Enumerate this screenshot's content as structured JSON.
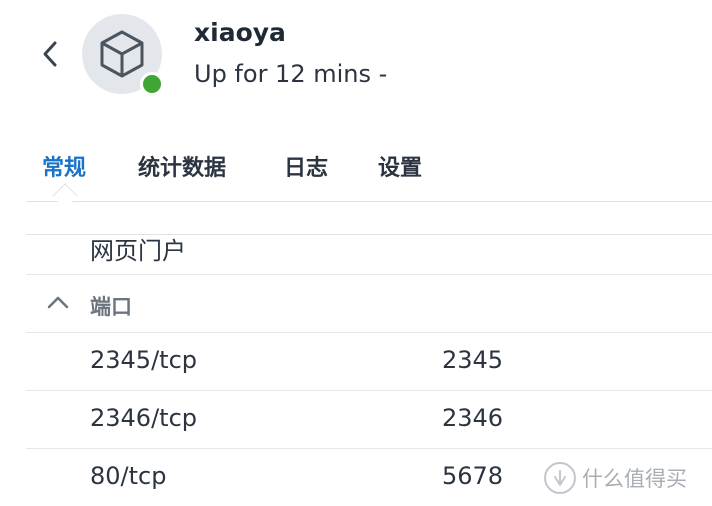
{
  "header": {
    "title": "xiaoya",
    "subtitle": "Up for 12 mins -",
    "status_color": "#3fa535"
  },
  "tabs": [
    {
      "label": "常规",
      "active": true
    },
    {
      "label": "统计数据",
      "active": false
    },
    {
      "label": "日志",
      "active": false
    },
    {
      "label": "设置",
      "active": false
    }
  ],
  "list": {
    "partial_row_label": "网页门户",
    "ports_section": {
      "label": "端口",
      "expanded": true,
      "rows": [
        {
          "container": "2345/tcp",
          "host": "2345"
        },
        {
          "container": "2346/tcp",
          "host": "2346"
        },
        {
          "container": "80/tcp",
          "host": "5678"
        }
      ]
    }
  },
  "watermark": {
    "text": "什么值得买"
  },
  "colors": {
    "accent": "#1a73c8",
    "text": "#2b3440",
    "divider": "#dfe3e8"
  }
}
